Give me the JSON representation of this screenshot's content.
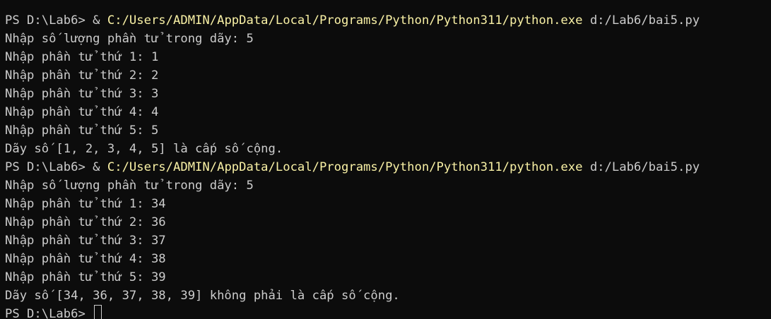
{
  "colors": {
    "background": "#0c0c0c",
    "foreground": "#cccccc",
    "command_highlight": "#f9f1a5"
  },
  "runs": [
    {
      "prompt": "PS D:\\Lab6> & ",
      "exe": "C:/Users/ADMIN/AppData/Local/Programs/Python/Python311/python.exe",
      "arg": " d:/Lab6/bai5.py",
      "output": [
        "Nhập số lượng phần tử trong dãy: 5",
        "Nhập phần tử thứ 1: 1",
        "Nhập phần tử thứ 2: 2",
        "Nhập phần tử thứ 3: 3",
        "Nhập phần tử thứ 4: 4",
        "Nhập phần tử thứ 5: 5",
        "Dãy số [1, 2, 3, 4, 5] là cấp số cộng."
      ]
    },
    {
      "prompt": "PS D:\\Lab6> & ",
      "exe": "C:/Users/ADMIN/AppData/Local/Programs/Python/Python311/python.exe",
      "arg": " d:/Lab6/bai5.py",
      "output": [
        "Nhập số lượng phần tử trong dãy: 5",
        "Nhập phần tử thứ 1: 34",
        "Nhập phần tử thứ 2: 36",
        "Nhập phần tử thứ 3: 37",
        "Nhập phần tử thứ 4: 38",
        "Nhập phần tử thứ 5: 39",
        "Dãy số [34, 36, 37, 38, 39] không phải là cấp số cộng."
      ]
    }
  ],
  "final_prompt": "PS D:\\Lab6> "
}
